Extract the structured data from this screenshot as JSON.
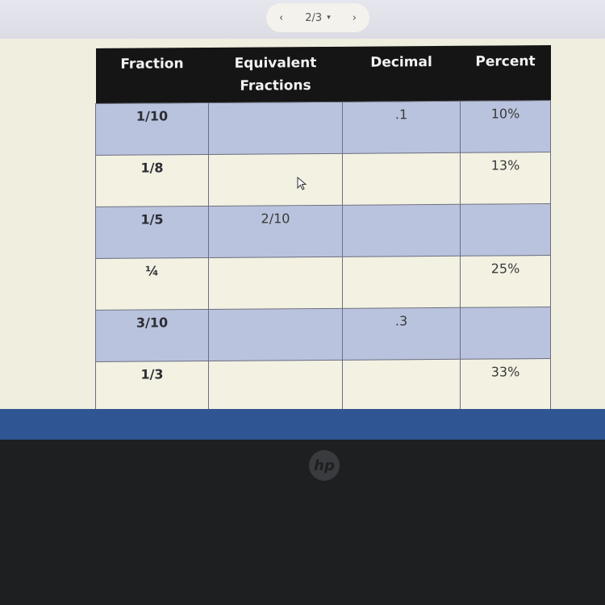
{
  "pager": {
    "prev_icon": "‹",
    "page_indicator": "2/3",
    "dropdown_icon": "▾",
    "next_icon": "›"
  },
  "table": {
    "headers": [
      "Fraction",
      "Equivalent Fractions",
      "Decimal",
      "Percent"
    ],
    "rows": [
      {
        "fraction": "1/10",
        "equivalent": "",
        "decimal": ".1",
        "percent": "10%"
      },
      {
        "fraction": "1/8",
        "equivalent": "",
        "decimal": "",
        "percent": "13%"
      },
      {
        "fraction": "1/5",
        "equivalent": "2/10",
        "decimal": "",
        "percent": ""
      },
      {
        "fraction": "¼",
        "equivalent": "",
        "decimal": "",
        "percent": "25%"
      },
      {
        "fraction": "3/10",
        "equivalent": "",
        "decimal": ".3",
        "percent": ""
      },
      {
        "fraction": "1/3",
        "equivalent": "",
        "decimal": "",
        "percent": "33%"
      }
    ]
  },
  "bezel": {
    "logo": "hp"
  },
  "colors": {
    "header_bg": "#151515",
    "shaded_row": "#b9c3dd",
    "plain_row": "#f3f1e2",
    "taskbar": "#2f5592"
  }
}
